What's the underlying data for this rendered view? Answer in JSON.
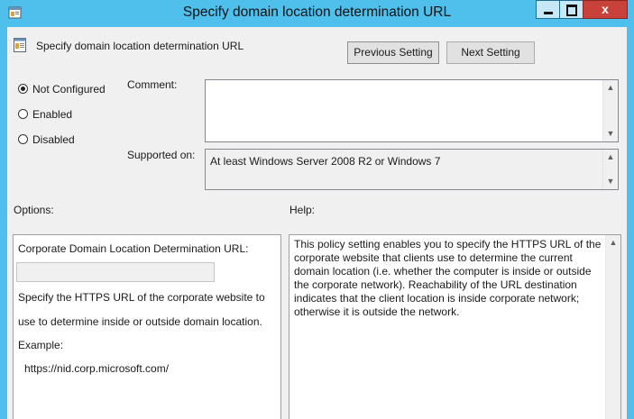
{
  "window": {
    "title": "Specify domain location determination URL",
    "close_glyph": "x"
  },
  "header": {
    "setting_name": "Specify domain location determination URL",
    "previous_setting_label": "Previous Setting",
    "next_setting_label": "Next Setting"
  },
  "state": {
    "options": [
      {
        "label": "Not Configured",
        "checked": true
      },
      {
        "label": "Enabled",
        "checked": false
      },
      {
        "label": "Disabled",
        "checked": false
      }
    ]
  },
  "comment": {
    "label": "Comment:",
    "value": ""
  },
  "supported": {
    "label": "Supported on:",
    "value": "At least Windows Server 2008 R2 or Windows 7"
  },
  "options_panel": {
    "heading": "Options:",
    "field_label": "Corporate Domain Location Determination URL:",
    "field_value": "",
    "desc_line1": "Specify the HTTPS URL of the corporate website to",
    "desc_line2": "use to determine inside or outside domain location.",
    "example_label": "Example:",
    "example_value": "https://nid.corp.microsoft.com/"
  },
  "help_panel": {
    "heading": "Help:",
    "lines": [
      "This policy setting enables you to specify the HTTPS URL of the",
      "corporate website that clients use to determine the current",
      "domain location (i.e. whether the computer is inside or outside",
      "the corporate network). Reachability of the URL destination",
      "indicates that the client location is inside corporate network;",
      "otherwise it is outside the network."
    ]
  },
  "colors": {
    "titlebar": "#4fc0ec",
    "close_button": "#c8413a",
    "dialog_background": "#f0f0f0"
  }
}
